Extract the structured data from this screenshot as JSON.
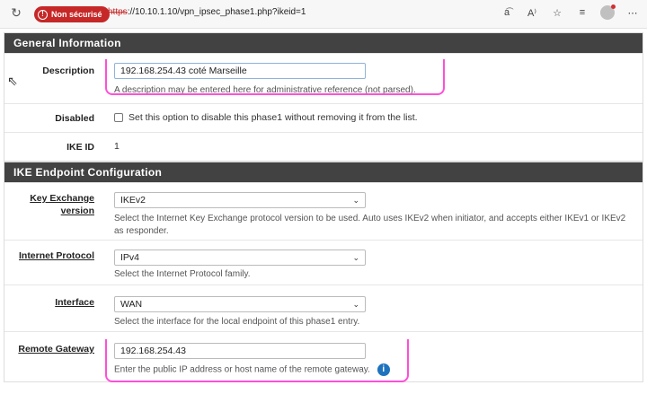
{
  "browser": {
    "security_label": "Non sécurisé",
    "url_proto": "https",
    "url_rest": "://10.10.1.10/vpn_ipsec_phase1.php?ikeid=1",
    "icons": [
      "reload-icon",
      "read-aloud-icon",
      "text-size-icon",
      "favorite-icon",
      "collections-icon",
      "profile-icon",
      "more-icon"
    ]
  },
  "general": {
    "header": "General Information",
    "description_label": "Description",
    "description_value": "192.168.254.43 coté Marseille",
    "description_help": "A description may be entered here for administrative reference (not parsed).",
    "disabled_label": "Disabled",
    "disabled_text": "Set this option to disable this phase1 without removing it from the list.",
    "ikeid_label": "IKE ID",
    "ikeid_value": "1"
  },
  "endpoint": {
    "header": "IKE Endpoint Configuration",
    "key_exchange_label_1": "Key Exchange",
    "key_exchange_label_2": "version",
    "key_exchange_value": "IKEv2",
    "key_exchange_help": "Select the Internet Key Exchange protocol version to be used. Auto uses IKEv2 when initiator, and accepts either IKEv1 or IKEv2 as responder.",
    "protocol_label": "Internet Protocol",
    "protocol_value": "IPv4",
    "protocol_help": "Select the Internet Protocol family.",
    "interface_label": "Interface",
    "interface_value": "WAN",
    "interface_help": "Select the interface for the local endpoint of this phase1 entry.",
    "gateway_label": "Remote Gateway",
    "gateway_value": "192.168.254.43",
    "gateway_help": "Enter the public IP address or host name of the remote gateway."
  },
  "colors": {
    "header_bg": "#424242",
    "insecure": "#c62828",
    "highlight": "#ff4fd8",
    "info": "#1e73be"
  }
}
